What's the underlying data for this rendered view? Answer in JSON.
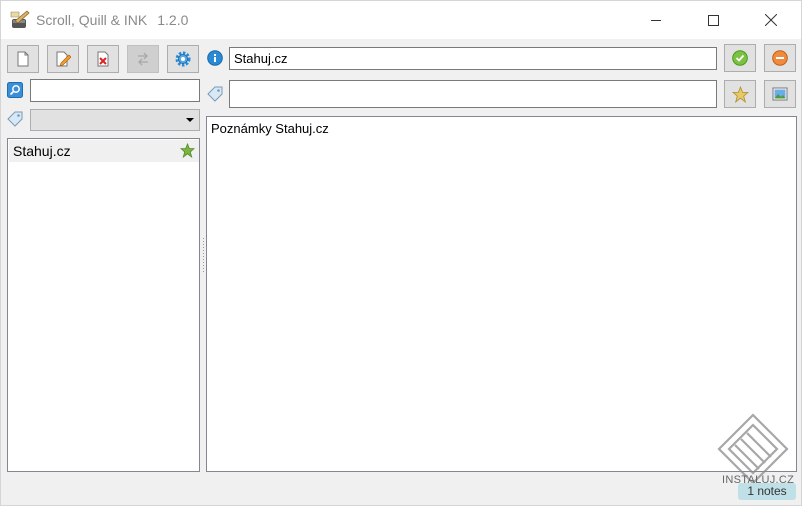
{
  "window": {
    "app_name": "Scroll, Quill & INK",
    "version": "1.2.0"
  },
  "toolbar": {
    "buttons": [
      {
        "name": "new-note-button",
        "icon": "new-document-icon"
      },
      {
        "name": "edit-note-button",
        "icon": "edit-document-icon"
      },
      {
        "name": "delete-note-button",
        "icon": "delete-document-icon"
      },
      {
        "name": "move-note-button",
        "icon": "transfer-icon",
        "disabled": true
      },
      {
        "name": "settings-button",
        "icon": "gear-icon"
      }
    ]
  },
  "search": {
    "value": "",
    "icon": "search-icon"
  },
  "tag_filter": {
    "selected": "",
    "icon": "tag-icon"
  },
  "note_list": {
    "items": [
      {
        "title": "Stahuj.cz",
        "favorite": true
      }
    ]
  },
  "editor": {
    "title_value": "Stahuj.cz",
    "info_icon": "info-icon",
    "tags_value": "",
    "tags_icon": "tag-icon",
    "body": "Poznámky Stahuj.cz",
    "save_icon": "check-icon",
    "cancel_icon": "minus-circle-icon",
    "favorite_icon": "star-icon",
    "image_icon": "picture-icon"
  },
  "watermark": {
    "text": "INSTALUJ.CZ"
  },
  "status": {
    "notes_count": "1 notes"
  },
  "colors": {
    "accent_green": "#7cb342",
    "cancel_orange": "#f08a3c",
    "info_blue": "#2a8ad6",
    "status_bg": "#bfe0e6"
  }
}
